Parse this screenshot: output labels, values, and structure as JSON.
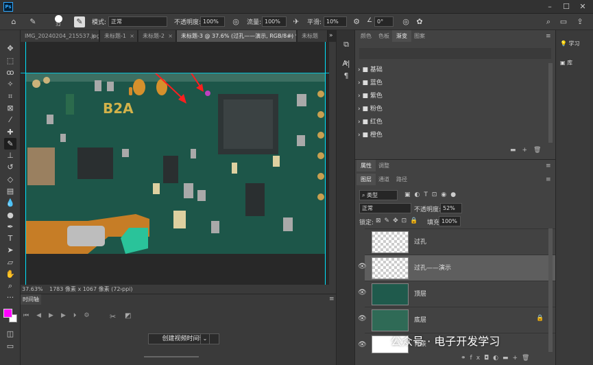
{
  "app": {
    "logo": "Ps"
  },
  "options_bar": {
    "mode_label": "模式:",
    "mode_value": "正常",
    "opacity_label": "不透明度:",
    "opacity_value": "100%",
    "flow_label": "流量:",
    "flow_value": "100%",
    "smooth_label": "平滑:",
    "smooth_value": "10%",
    "angle_value": "0°",
    "brush_size": "32"
  },
  "doc_tabs": [
    {
      "label": "IMG_20240204_215537.jpg"
    },
    {
      "label": "未标题-1"
    },
    {
      "label": "未标题-2"
    },
    {
      "label": "未标题-3 @ 37.6% (过孔——演示, RGB/8#) *"
    },
    {
      "label": "未标题"
    }
  ],
  "status": {
    "zoom": "37.63%",
    "doc_info": "1783 像素 x 1067 像素 (72 ppi)"
  },
  "timeline": {
    "tab": "时间轴",
    "create_button": "创建视频时间轴"
  },
  "swatches": {
    "tabs": [
      "颜色",
      "色板",
      "渐变",
      "图案"
    ],
    "folders": [
      "基础",
      "蓝色",
      "紫色",
      "粉色",
      "红色",
      "橙色"
    ]
  },
  "props": {
    "tabs": [
      "属性",
      "调整"
    ]
  },
  "layers": {
    "tabs": [
      "图层",
      "通道",
      "路径"
    ],
    "filter_kind": "类型",
    "blend_mode": "正常",
    "opacity_label": "不透明度:",
    "opacity_value": "52%",
    "lock_label": "锁定:",
    "fill_label": "填充:",
    "fill_value": "100%",
    "items": [
      {
        "name": "过孔"
      },
      {
        "name": "过孔——演示"
      },
      {
        "name": "顶层"
      },
      {
        "name": "底层"
      },
      {
        "name": "背景"
      }
    ]
  },
  "learn": {
    "items": [
      "学习",
      "库"
    ]
  },
  "watermark": "公众号 · 电子开发学习",
  "colors": {
    "foreground": "#ff00ff",
    "background": "#ffffff",
    "marker": "#c040c0",
    "arrow": "#ff1e1e"
  }
}
